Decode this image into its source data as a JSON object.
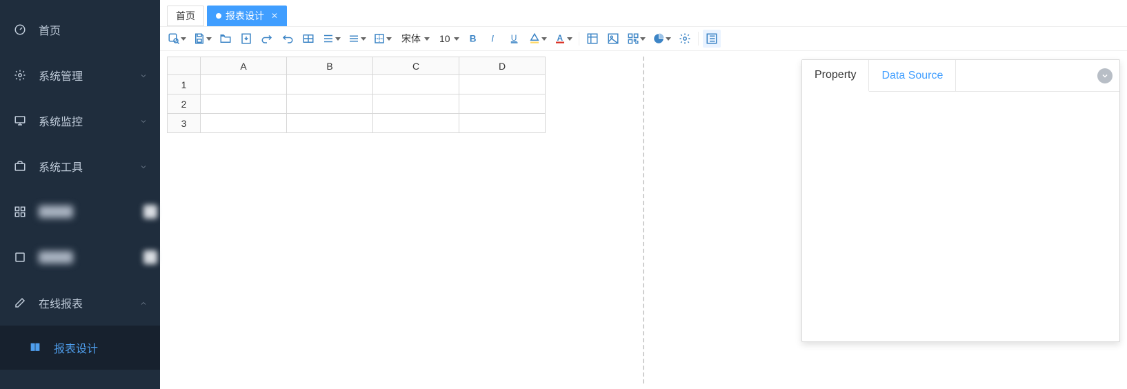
{
  "sidebar": {
    "items": [
      {
        "icon": "dashboard-icon",
        "label": "首页",
        "expandable": false
      },
      {
        "icon": "gear-icon",
        "label": "系统管理",
        "expandable": true
      },
      {
        "icon": "monitor-icon",
        "label": "系统监控",
        "expandable": true
      },
      {
        "icon": "briefcase-icon",
        "label": "系统工具",
        "expandable": true
      },
      {
        "icon": "grid-icon",
        "label": "",
        "expandable": false,
        "obscured": true
      },
      {
        "icon": "blank-icon",
        "label": "",
        "expandable": false,
        "obscured": true
      },
      {
        "icon": "edit-icon",
        "label": "在线报表",
        "expandable": true,
        "expanded": true
      }
    ],
    "sub": {
      "icon": "book-icon",
      "label": "报表设计"
    }
  },
  "tabs": [
    {
      "label": "首页",
      "active": false,
      "closable": false
    },
    {
      "label": "报表设计",
      "active": true,
      "closable": true,
      "modified": true
    }
  ],
  "toolbar": {
    "font_name": "宋体",
    "font_size": "10"
  },
  "sheet": {
    "columns": [
      "A",
      "B",
      "C",
      "D"
    ],
    "rows": [
      "1",
      "2",
      "3"
    ]
  },
  "panel": {
    "tabs": [
      {
        "label": "Property",
        "active": true
      },
      {
        "label": "Data Source",
        "active": false
      }
    ]
  }
}
